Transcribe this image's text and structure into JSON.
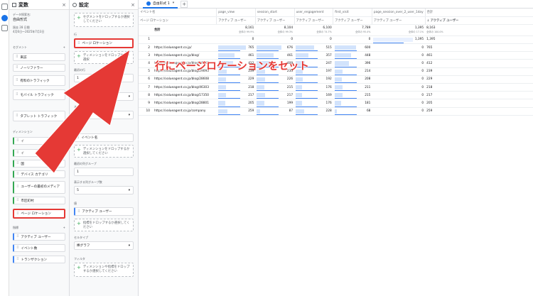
{
  "variables_panel": {
    "title": "変数",
    "close": "×",
    "exploration_name_label": "データ探索名:",
    "exploration_name": "自由形式",
    "daterange_label": "過去 28 日間",
    "daterange_value": "4月6日～2025年7月3日",
    "segments_title": "セグメント",
    "segments": [
      "来訪",
      "ノーリファラー",
      "有料のトラフィック",
      "モバイル トラフィック",
      "タブレット トラフィック"
    ],
    "dimensions_title": "ディメンション",
    "dimensions": [
      "イ",
      "イ",
      "国",
      "デバイス カテゴリ",
      "ユーザーの最初のメディア",
      "市区町村",
      "ページ ロケーション"
    ],
    "metrics_title": "指標",
    "metrics": [
      "アクティブ ユーザー",
      "イベント数",
      "トランザクション"
    ]
  },
  "settings_panel": {
    "title": "設定",
    "close": "×",
    "segment_drop": "セグメントをドロップするか選択してください",
    "rows_label": "行",
    "row_chip": "ページ ロケーション",
    "row_drop": "ディメンションをドロップするか選択",
    "start_row_label": "最初の行",
    "start_row_value": "1",
    "rows_shown_label": "表示する行数",
    "rows_shown_value": "10",
    "nested_label": "ネストされた行",
    "nested_value": "No",
    "columns_label": "列",
    "column_chip": "イベント名",
    "column_drop": "ディメンションをドロップするか選択してください",
    "start_col_label": "最初の列グループ",
    "start_col_value": "1",
    "cols_shown_label": "表示する列グループ数",
    "cols_shown_value": "5",
    "values_label": "値",
    "value_chip": "アクティブ ユーザー",
    "value_drop": "指標をドロップするか選択してください",
    "cell_type_label": "セルタイプ",
    "cell_type_value": "棒グラフ",
    "filters_label": "フィルタ",
    "filter_drop": "ディメンションや指標をドロップするか選択してください"
  },
  "tab": {
    "label": "自由形式 1",
    "add": "+"
  },
  "table": {
    "corner_top": "イベント名",
    "corner_sub": "ページ ロケーション",
    "columns": [
      "page_view",
      "session_start",
      "user_engagement",
      "first_visit",
      "page_session_over_2_user_1day",
      "合計"
    ],
    "metric_label": "アクティブ ユーザー",
    "total_label": "合計",
    "totals": [
      "8,161",
      "8,104",
      "6,100",
      "7,789",
      "1,395",
      "8,163"
    ],
    "totals_sub": [
      "全体の 99.9%",
      "全体の 99.3%",
      "全体の 74.7%",
      "全体の 95.4%",
      "全体の 17.1%",
      "全体の 100.0%"
    ],
    "rows": [
      {
        "n": "1",
        "url": "",
        "v": [
          "0",
          "0",
          "0",
          "0",
          "1,395",
          "1,395"
        ]
      },
      {
        "n": "2",
        "url": "https://valueagent.co.jp/",
        "v": [
          "765",
          "676",
          "515",
          "600",
          "0",
          "765"
        ]
      },
      {
        "n": "3",
        "url": "https://valueagent.co.jp/blog/",
        "v": [
          "461",
          "461",
          "357",
          "448",
          "0",
          "461"
        ]
      },
      {
        "n": "4",
        "url": "https://valueagent.co.jp/blog/26042",
        "v": [
          "412",
          "409",
          "247",
          "396",
          "0",
          "412"
        ]
      },
      {
        "n": "5",
        "url": "https://valueagent.co.jp/blog/29093",
        "v": [
          "239",
          "235",
          "197",
          "214",
          "0",
          "239"
        ]
      },
      {
        "n": "6",
        "url": "https://valueagent.co.jp/blog/28608",
        "v": [
          "229",
          "226",
          "192",
          "208",
          "0",
          "229"
        ]
      },
      {
        "n": "7",
        "url": "https://valueagent.co.jp/blog/46303",
        "v": [
          "218",
          "215",
          "176",
          "211",
          "0",
          "218"
        ]
      },
      {
        "n": "8",
        "url": "https://valueagent.co.jp/blog/17350",
        "v": [
          "217",
          "217",
          "169",
          "215",
          "0",
          "217"
        ]
      },
      {
        "n": "9",
        "url": "https://valueagent.co.jp/blog/28801",
        "v": [
          "205",
          "199",
          "176",
          "181",
          "0",
          "205"
        ]
      },
      {
        "n": "10",
        "url": "https://valueagent.co.jp/company",
        "v": [
          "259",
          "87",
          "228",
          "68",
          "0",
          "259"
        ]
      }
    ]
  },
  "callout": "行にページロケーションをセット",
  "colors": {
    "accent": "#1a73e8",
    "annotation": "#e53935",
    "bar": "#d2e3fc"
  }
}
